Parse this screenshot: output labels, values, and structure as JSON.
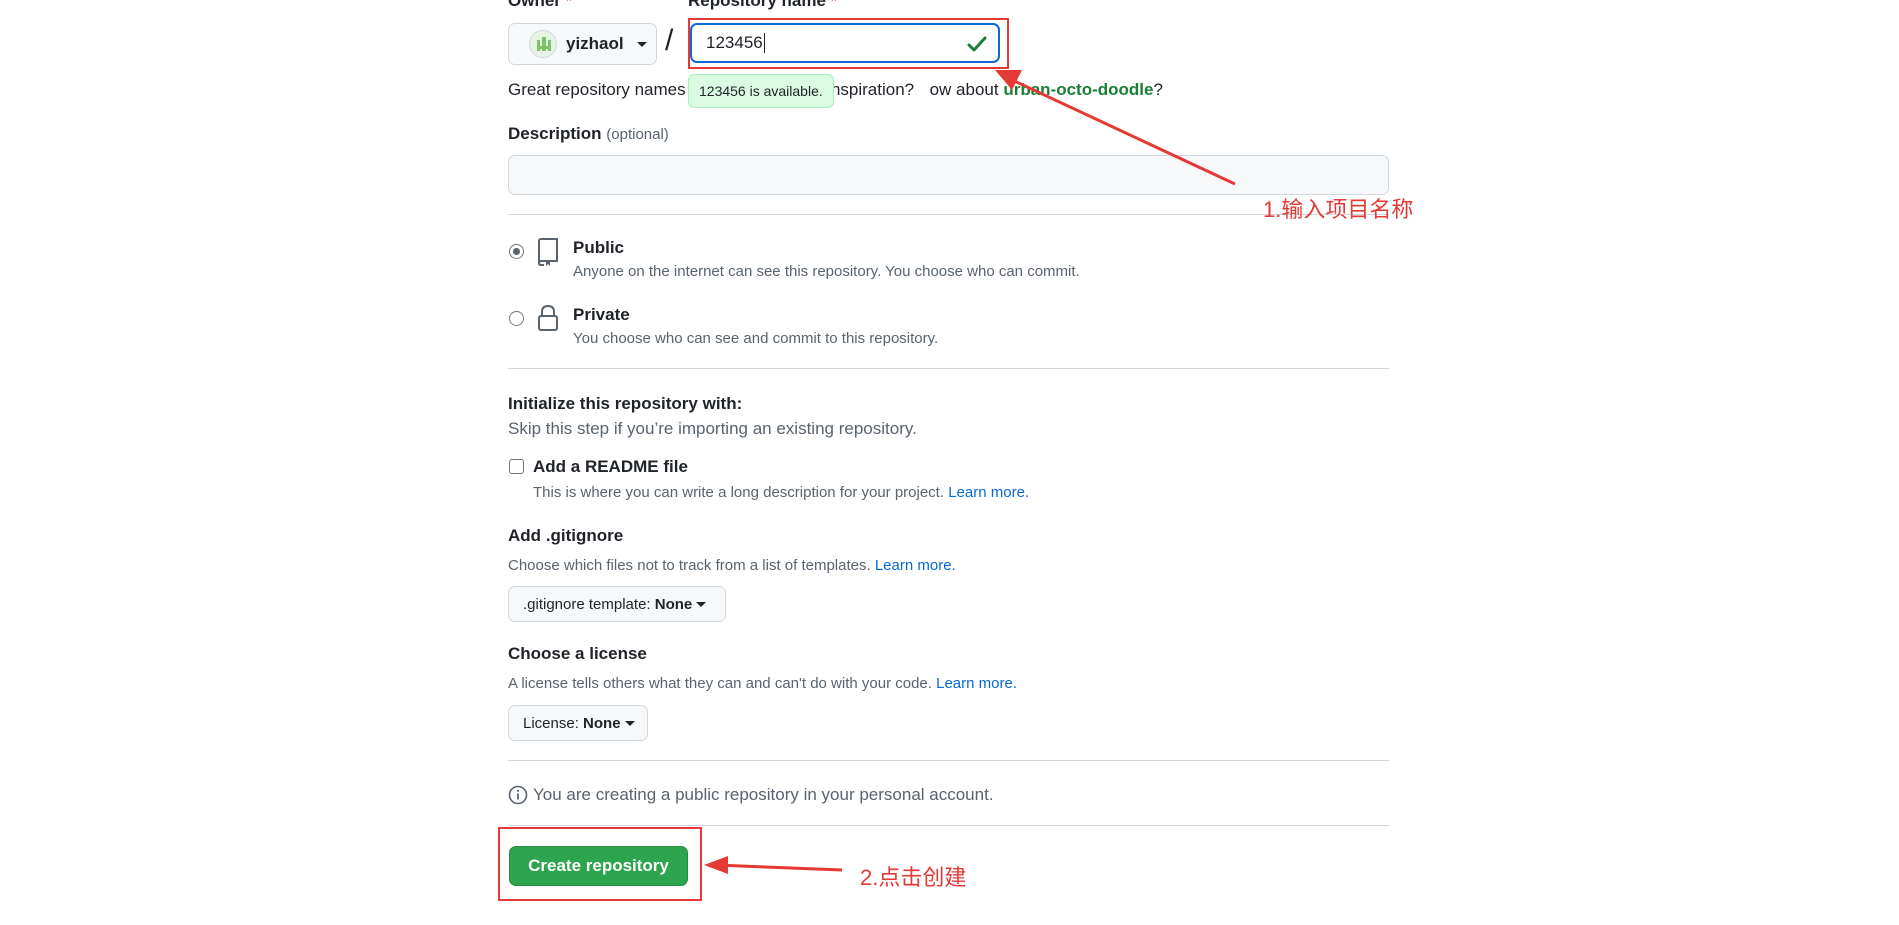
{
  "owner": {
    "label": "Owner",
    "required_mark": "*",
    "value": "yizhaol"
  },
  "separator": "/",
  "repo_name": {
    "label": "Repository name",
    "required_mark": "*",
    "value": "123456"
  },
  "availability_tooltip": "123456 is available.",
  "hint": {
    "prefix": "Great repository names",
    "middle": "orable. Need inspiration?",
    "middle2": "ow about",
    "suggestion": "urban-octo-doodle",
    "suffix": "?"
  },
  "description": {
    "label": "Description",
    "optional": "(optional)",
    "value": ""
  },
  "visibility": {
    "public": {
      "title": "Public",
      "desc": "Anyone on the internet can see this repository. You choose who can commit."
    },
    "private": {
      "title": "Private",
      "desc": "You choose who can see and commit to this repository."
    }
  },
  "init": {
    "title": "Initialize this repository with:",
    "subtitle": "Skip this step if you’re importing an existing repository.",
    "readme_label": "Add a README file",
    "readme_desc": "This is where you can write a long description for your project.",
    "learn_more": "Learn more."
  },
  "gitignore": {
    "title": "Add .gitignore",
    "desc": "Choose which files not to track from a list of templates.",
    "learn_more": "Learn more.",
    "select_prefix": ".gitignore template:",
    "select_value": "None"
  },
  "license": {
    "title": "Choose a license",
    "desc": "A license tells others what they can and can't do with your code.",
    "learn_more": "Learn more.",
    "select_prefix": "License:",
    "select_value": "None"
  },
  "notice": "You are creating a public repository in your personal account.",
  "create_button": "Create repository",
  "annotations": {
    "step1": "1.输入项目名称",
    "step2": "2.点击创建",
    "color": "#e53935"
  }
}
